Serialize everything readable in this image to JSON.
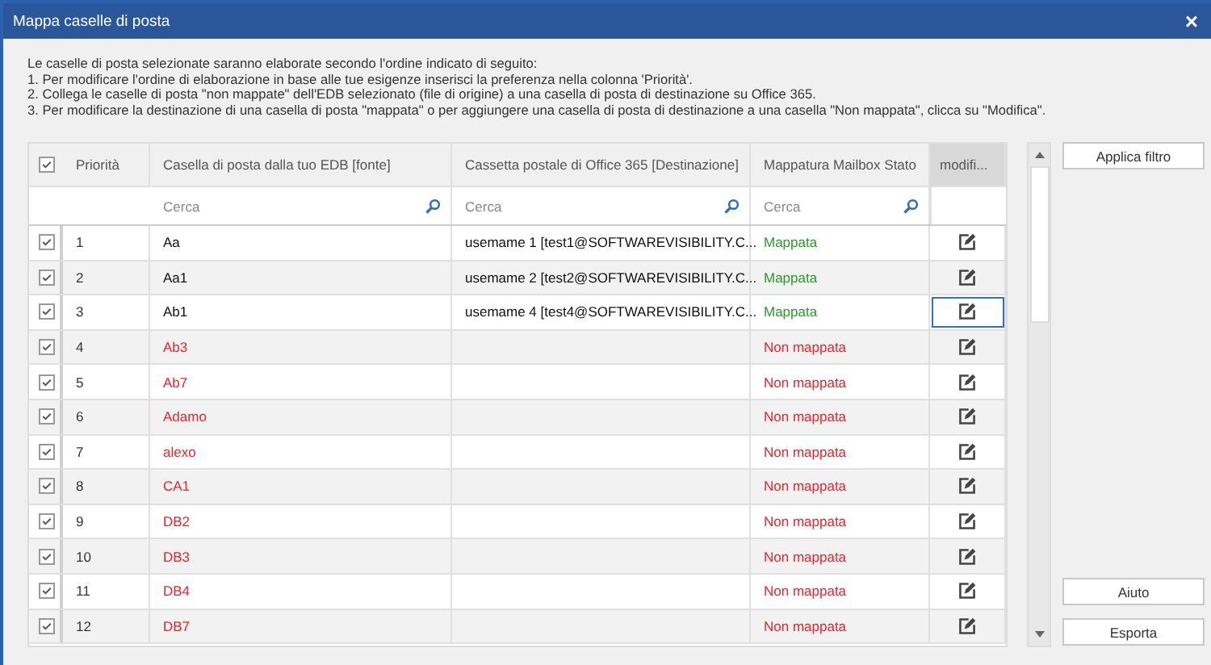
{
  "window": {
    "title": "Mappa caselle di posta",
    "close": "×"
  },
  "instructions": [
    "Le caselle di posta selezionate saranno elaborate secondo l'ordine indicato di seguito:",
    "1. Per modificare l'ordine di elaborazione in base alle tue esigenze inserisci la preferenza nella colonna 'Priorità'.",
    "2. Collega le caselle di posta \"non mappate\" dell'EDB selezionato (file di origine) a una casella di posta di destinazione su Office 365.",
    "3. Per modificare la destinazione di una casella di posta \"mappata\" o per aggiungere una casella di posta di destinazione a una casella \"Non mappata\", clicca su \"Modifica\"."
  ],
  "table": {
    "header_checked": true,
    "columns": [
      "Priorità",
      "Casella di posta dalla tuo EDB [fonte]",
      "Cassetta postale di Office 365 [Destinazione]",
      "Mappatura Mailbox Stato",
      "modifi..."
    ],
    "search_placeholders": [
      "Cerca",
      "Cerca",
      "Cerca"
    ],
    "rows": [
      {
        "checked": true,
        "priority": "1",
        "source": "Aa",
        "destination": "usemame 1 [test1@SOFTWAREVISIBILITY.C...",
        "status": "Mappata",
        "kind": "mapped",
        "selected": false
      },
      {
        "checked": true,
        "priority": "2",
        "source": "Aa1",
        "destination": "usemame 2 [test2@SOFTWAREVISIBILITY.C...",
        "status": "Mappata",
        "kind": "mapped",
        "selected": false
      },
      {
        "checked": true,
        "priority": "3",
        "source": "Ab1",
        "destination": "usemame 4 [test4@SOFTWAREVISIBILITY.C...",
        "status": "Mappata",
        "kind": "mapped",
        "selected": true
      },
      {
        "checked": true,
        "priority": "4",
        "source": "Ab3",
        "status": "Non mappata",
        "kind": "unmapped",
        "selected": false
      },
      {
        "checked": true,
        "priority": "5",
        "source": "Ab7",
        "status": "Non mappata",
        "kind": "unmapped",
        "selected": false
      },
      {
        "checked": true,
        "priority": "6",
        "source": "Adamo",
        "status": "Non mappata",
        "kind": "unmapped",
        "selected": false
      },
      {
        "checked": true,
        "priority": "7",
        "source": "alexo",
        "status": "Non mappata",
        "kind": "unmapped",
        "selected": false
      },
      {
        "checked": true,
        "priority": "8",
        "source": "CA1",
        "status": "Non mappata",
        "kind": "unmapped",
        "selected": false
      },
      {
        "checked": true,
        "priority": "9",
        "source": "DB2",
        "status": "Non mappata",
        "kind": "unmapped",
        "selected": false
      },
      {
        "checked": true,
        "priority": "10",
        "source": "DB3",
        "status": "Non mappata",
        "kind": "unmapped",
        "selected": false
      },
      {
        "checked": true,
        "priority": "11",
        "source": "DB4",
        "status": "Non mappata",
        "kind": "unmapped",
        "selected": false
      },
      {
        "checked": true,
        "priority": "12",
        "source": "DB7",
        "status": "Non mappata",
        "kind": "unmapped",
        "selected": false
      }
    ]
  },
  "buttons": {
    "filter": "Applica filtro",
    "help": "Aiuto",
    "export": "Esporta"
  }
}
